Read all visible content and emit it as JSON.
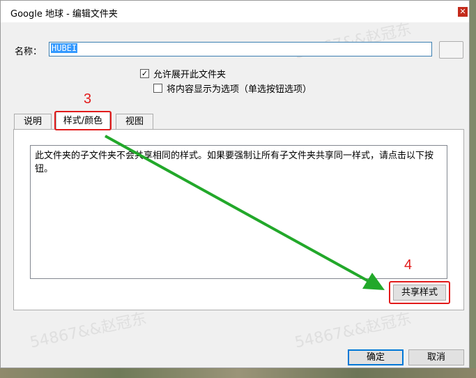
{
  "window": {
    "title": "Google 地球 - 编辑文件夹",
    "close_glyph": "✕"
  },
  "name_field": {
    "label": "名称：",
    "value": "HUBEI"
  },
  "options": [
    {
      "label": "允许展开此文件夹",
      "checked": true
    },
    {
      "label": "将内容显示为选项（单选按钮选项）",
      "checked": false
    }
  ],
  "annotations": {
    "step3": "3",
    "step4": "4"
  },
  "tabs": [
    {
      "label": "说明",
      "active": false
    },
    {
      "label": "样式/颜色",
      "active": true
    },
    {
      "label": "视图",
      "active": false
    }
  ],
  "style_tab": {
    "description": "此文件夹的子文件夹不会共享相同的样式。如果要强制让所有子文件夹共享同一样式，请点击以下按钮。",
    "share_button": "共享样式"
  },
  "footer": {
    "ok": "确定",
    "cancel": "取消"
  },
  "watermark": "54867&&赵冠东",
  "colors": {
    "annotation_red": "#e21b1b",
    "arrow_green": "#22a82a",
    "selection_blue": "#3399ff"
  }
}
